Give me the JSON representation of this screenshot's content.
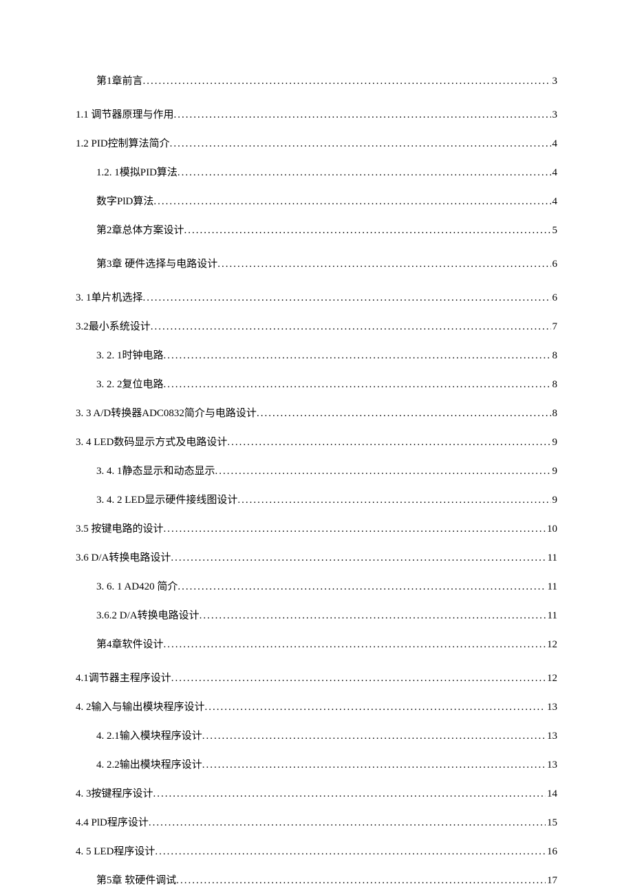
{
  "toc": [
    {
      "label": "第1章前言",
      "page": "3",
      "indent": 1,
      "chapter": true
    },
    {
      "label": "1.1 调节器原理与作用 ",
      "page": "3",
      "indent": 0
    },
    {
      "label": "1.2 PID控制算法简介",
      "page": "4",
      "indent": 0
    },
    {
      "label": "1.2. 1模拟PID算法 ",
      "page": "4",
      "indent": 2
    },
    {
      "label": "数字PlD算法 ",
      "page": "4",
      "indent": 2
    },
    {
      "label": "第2章总体方案设计",
      "page": "5",
      "indent": 1,
      "chapter": true
    },
    {
      "label": "第3章 硬件选择与电路设计",
      "page": "6",
      "indent": 1,
      "chapter": true
    },
    {
      "label": "3. 1单片机选择 ",
      "page": "6",
      "indent": 0
    },
    {
      "label": "3.2最小系统设计 ",
      "page": "7",
      "indent": 0
    },
    {
      "label": "3. 2. 1时钟电路 ",
      "page": "8",
      "indent": 2
    },
    {
      "label": "3. 2. 2复位电路 ",
      "page": "8",
      "indent": 2
    },
    {
      "label": "3. 3 A/D转换器ADC0832简介与电路设计 ",
      "page": "8",
      "indent": 0
    },
    {
      "label": "3. 4 LED数码显示方式及电路设计 ",
      "page": "9",
      "indent": 0
    },
    {
      "label": "3. 4. 1静态显示和动态显示 ",
      "page": "9",
      "indent": 2
    },
    {
      "label": "3. 4. 2 LED显示硬件接线图设计",
      "page": "9",
      "indent": 2
    },
    {
      "label": "3.5 按键电路的设计",
      "page": "10",
      "indent": 0
    },
    {
      "label": "3.6 D/A转换电路设计",
      "page": "11",
      "indent": 0
    },
    {
      "label": "3. 6. 1 AD420 简介 ",
      "page": "11",
      "indent": 2
    },
    {
      "label": "3.6.2 D/A转换电路设计",
      "page": "11",
      "indent": 2
    },
    {
      "label": "第4章软件设计 ",
      "page": "12",
      "indent": 1,
      "chapter": true
    },
    {
      "label": "4.1调节器主程序设计 ",
      "page": "12",
      "indent": 0
    },
    {
      "label": "4. 2输入与输出模块程序设计 ",
      "page": "13",
      "indent": 0
    },
    {
      "label": "4. 2.1输入模块程序设计 ",
      "page": "13",
      "indent": 2
    },
    {
      "label": "4. 2.2输出模块程序设计 ",
      "page": "13",
      "indent": 2
    },
    {
      "label": "4. 3按键程序设计 ",
      "page": "14",
      "indent": 0
    },
    {
      "label": "4.4 PlD程序设计",
      "page": "15",
      "indent": 0
    },
    {
      "label": "4. 5 LED程序设计",
      "page": "16",
      "indent": 0
    },
    {
      "label": "第5章 软硬件调试 ",
      "page": "17",
      "indent": 1,
      "chapter": true
    }
  ]
}
